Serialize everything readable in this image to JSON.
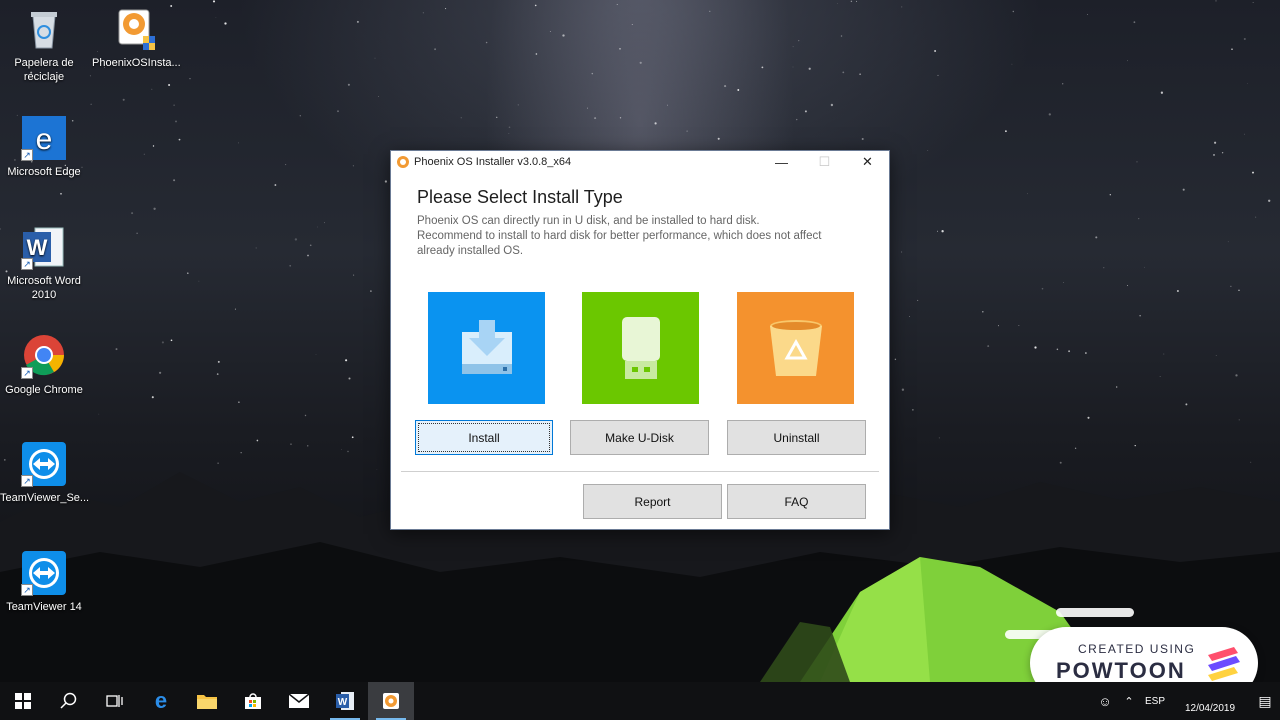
{
  "desktop": {
    "icons": [
      {
        "label": "Papelera de reciclaje",
        "icon": "recycle-bin-icon"
      },
      {
        "label": "PhoenixOSInsta...",
        "icon": "phoenix-installer-icon"
      },
      {
        "label": "Microsoft Edge",
        "icon": "edge-icon"
      },
      {
        "label": "Microsoft Word 2010",
        "icon": "word-icon"
      },
      {
        "label": "Google Chrome",
        "icon": "chrome-icon"
      },
      {
        "label": "TeamViewer_Se...",
        "icon": "teamviewer-icon"
      },
      {
        "label": "TeamViewer 14",
        "icon": "teamviewer-icon"
      }
    ]
  },
  "window": {
    "title": "Phoenix OS Installer v3.0.8_x64",
    "heading": "Please Select Install Type",
    "description": [
      "Phoenix OS can directly run in U disk, and be installed to hard disk.",
      "Recommend to install to hard disk for better performance, which does not affect",
      "already installed OS."
    ],
    "tiles": [
      {
        "label": "Install",
        "color": "#0a93f0",
        "icon": "hard-disk-download-icon"
      },
      {
        "label": "Make U-Disk",
        "color": "#6bc700",
        "icon": "usb-drive-icon"
      },
      {
        "label": "Uninstall",
        "color": "#f4922e",
        "icon": "recycle-bin-icon"
      }
    ],
    "report_label": "Report",
    "faq_label": "FAQ"
  },
  "taskbar": {
    "items": [
      "windows-start-icon",
      "search-icon",
      "task-view-icon",
      "edge-icon",
      "file-explorer-icon",
      "store-icon",
      "mail-icon",
      "word-icon",
      "phoenix-installer-icon"
    ],
    "language": "ESP",
    "date": "12/04/2019"
  },
  "powtoon": {
    "small_text": "CREATED USING",
    "brand": "POWTOON"
  }
}
